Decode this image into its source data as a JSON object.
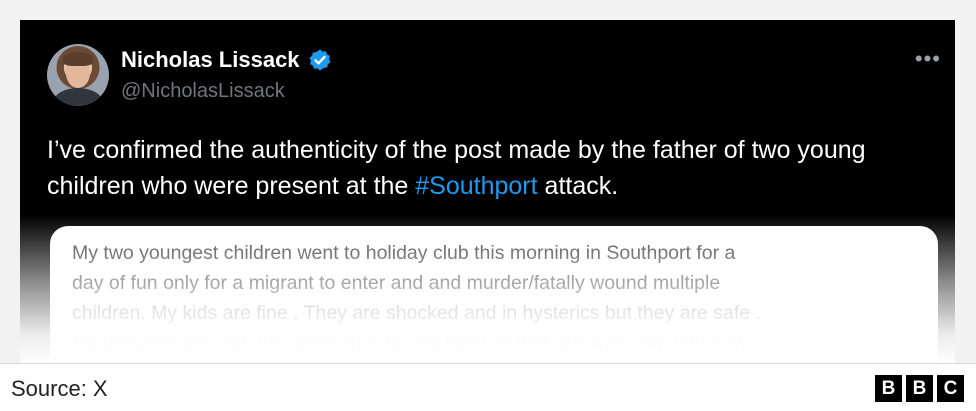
{
  "tweet": {
    "display_name": "Nicholas Lissack",
    "handle": "@NicholasLissack",
    "more_icon": "more-horizontal-icon",
    "verified_color": "#1d9bf0",
    "text_before": "I’ve confirmed the authenticity of the post made by the father of two young children who were present at the ",
    "hashtag": "#Southport",
    "text_after": " attack."
  },
  "quoted_post": {
    "lines": [
      "My two youngest children went to holiday club this morning in Southport for a",
      "day of fun only for a migrant to enter and and murder/fatally wound multiple",
      "children. My kids are fine . They are shocked and in hysterics but they are safe .",
      "My thoughts are with the other 30 kids and families that are suffering right now"
    ]
  },
  "footer": {
    "source": "Source: X",
    "logo_letters": [
      "B",
      "B",
      "C"
    ]
  }
}
